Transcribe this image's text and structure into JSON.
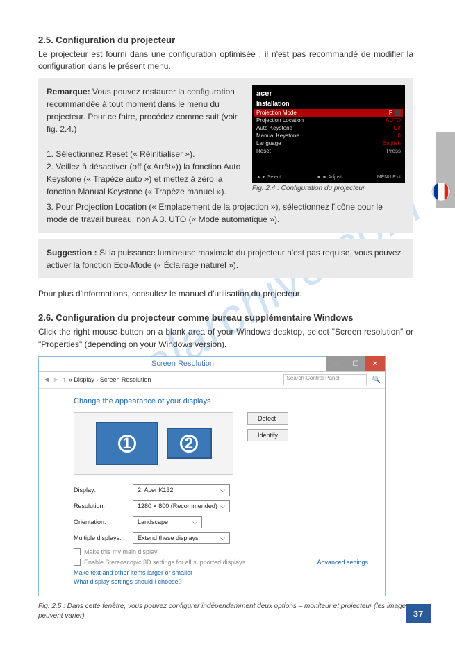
{
  "watermark": "manualarchive.com",
  "side_flag": "FR",
  "section25": {
    "heading": "2.5. Configuration du projecteur",
    "intro": "Le projecteur est fourni dans une configuration optimisée ; il n'est pas recommandé de modifier la configuration dans le présent menu."
  },
  "remarque": {
    "label": "Remarque:",
    "text1": " Vous pouvez restaurer la configuration recommandée à tout moment dans le menu du projecteur. Pour ce faire, procédez comme suit (voir fig. 2.4.)",
    "step1": "1. Sélectionnez Reset (« Réinitialiser »).",
    "step2": "2. Veillez à désactiver (off (« Arrêt»)) la fonction Auto Keystone (« Trapèze auto ») et mettez à zéro la fonction Manual Keystone (« Trapèze manuel »).",
    "step3": "3. Pour Projection Location (« Emplacement de la projection »), sélectionnez l'icône pour le mode de travail bureau, non A 3. UTO (« Mode automatique »)."
  },
  "projector": {
    "logo": "acer",
    "title": "Installation",
    "rows": [
      {
        "k": "Projection Mode",
        "v": ""
      },
      {
        "k": "Projection Location",
        "v": "AUTO"
      },
      {
        "k": "Auto Keystone",
        "v": "Off"
      },
      {
        "k": "Manual Keystone",
        "v": "0"
      },
      {
        "k": "Language",
        "v": "English"
      },
      {
        "k": "Reset",
        "v": "Press"
      }
    ],
    "foot_select": "▲▼ Select",
    "foot_adjust": "◄ ► Adjust",
    "foot_exit": "MENU Exit",
    "caption": "Fig. 2.4 : Configuration du projecteur"
  },
  "suggestion": {
    "label": "Suggestion :",
    "text": "  Si la puissance lumineuse maximale du projecteur n'est pas requise, vous pouvez activer la fonction Eco-Mode (« Éclairage naturel »)."
  },
  "more_info": "Pour plus d'informations, consultez le manuel d'utilisation du projecteur.",
  "section26": {
    "heading": "2.6. Configuration du projecteur comme bureau supplémentaire Windows",
    "intro": "Click the right mouse button on a blank area of your Windows desktop, select \"Screen resolution\" or \"Properties\" (depending on your Windows version)."
  },
  "win": {
    "title": "Screen Resolution",
    "breadcrumb": "« Display › Screen Resolution",
    "search_ph": "Search Control Panel",
    "instr": "Change the appearance of your displays",
    "detect": "Detect",
    "identify": "Identify",
    "mon1": "1",
    "mon2": "2",
    "display_lbl": "Display:",
    "display_val": "2. Acer K132",
    "res_lbl": "Resolution:",
    "res_val": "1280 × 800 (Recommended)",
    "orient_lbl": "Orientation:",
    "orient_val": "Landscape",
    "multi_lbl": "Multiple displays:",
    "multi_val": "Extend these displays",
    "chk1": "Make this my main display",
    "chk2": "Enable Stereoscopic 3D settings for all supported displays",
    "adv": "Advanced settings",
    "link1": "Make text and other items larger or smaller",
    "link2": "What display settings should I choose?"
  },
  "fig25": "Fig. 2.5 : Dans cette fenêtre, vous pouvez configurer indépendamment deux options – moniteur et projecteur (les images peuvent varier)",
  "page_number": "37"
}
